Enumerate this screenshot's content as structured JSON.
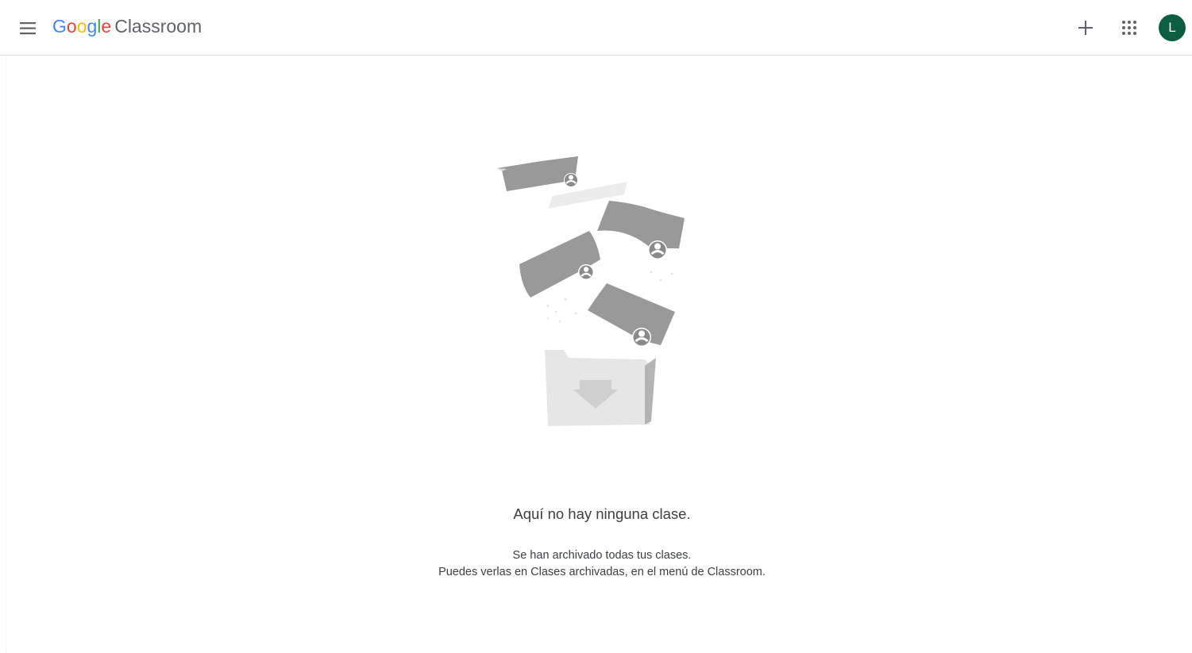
{
  "header": {
    "menu_icon": "hamburger-menu-icon",
    "brand": {
      "letters": [
        {
          "char": "G",
          "color": "#4285F4"
        },
        {
          "char": "o",
          "color": "#EA4335"
        },
        {
          "char": "o",
          "color": "#FBBC05"
        },
        {
          "char": "g",
          "color": "#4285F4"
        },
        {
          "char": "l",
          "color": "#34A853"
        },
        {
          "char": "e",
          "color": "#EA4335"
        }
      ],
      "product": "Classroom"
    },
    "actions": {
      "add_icon": "plus-icon",
      "apps_icon": "apps-grid-icon"
    },
    "avatar": {
      "initial": "L",
      "color": "#0b5e40"
    }
  },
  "empty_state": {
    "illustration_icon": "archived-classes-illustration",
    "title": "Aquí no hay ninguna clase.",
    "line1": "Se han archivado todas tus clases.",
    "line2": "Puedes verlas en Clases archivadas, en el menú de Classroom."
  }
}
